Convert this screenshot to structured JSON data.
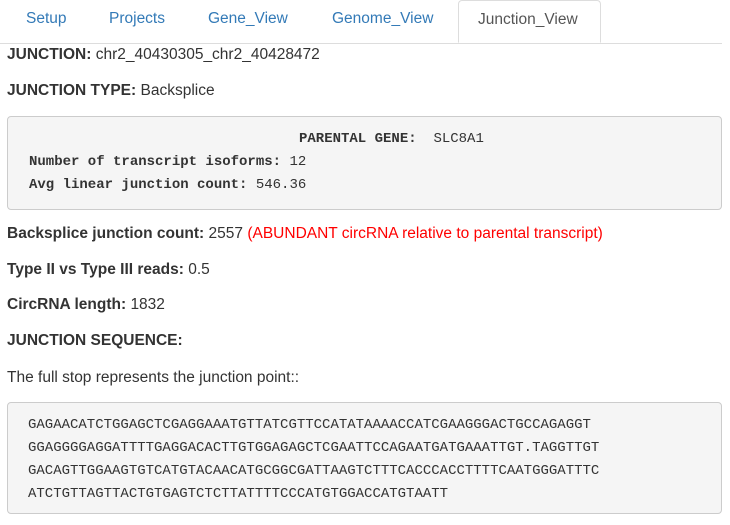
{
  "tabs": [
    {
      "label": "Setup",
      "active": false
    },
    {
      "label": "Projects",
      "active": false
    },
    {
      "label": "Gene_View",
      "active": false
    },
    {
      "label": "Genome_View",
      "active": false
    },
    {
      "label": "Junction_View",
      "active": true
    }
  ],
  "junction": {
    "label": "JUNCTION:",
    "value": "chr2_40430305_chr2_40428472"
  },
  "junction_type": {
    "label": "JUNCTION TYPE:",
    "value": "Backsplice"
  },
  "parental_box": {
    "gene_label": "PARENTAL GENE:",
    "gene_value": "SLC8A1",
    "isoforms_label": "Number of transcript isoforms:",
    "isoforms_value": "12",
    "avg_label": "Avg linear junction count:",
    "avg_value": "546.36"
  },
  "backsplice_count": {
    "label": "Backsplice junction count:",
    "value": "2557",
    "note": "(ABUNDANT circRNA relative to parental transcript)"
  },
  "type_reads": {
    "label": "Type II vs Type III reads:",
    "value": "0.5"
  },
  "circrna_length": {
    "label": "CircRNA length:",
    "value": "1832"
  },
  "junction_sequence": {
    "label": "JUNCTION SEQUENCE:",
    "description": "The full stop represents the junction point::",
    "lines": [
      "GAGAACATCTGGAGCTCGAGGAAATGTTATCGTTCCATATAAAACCATCGAAGGGACTGCCAGAGGT",
      "GGAGGGGAGGATTTTGAGGACACTTGTGGAGAGCTCGAATTCCAGAATGATGAAATTGT.TAGGTTGT",
      "GACAGTTGGAAGTGTCATGTACAACATGCGGCGATTAAGTCTTTCACCCACCTTTTCAATGGGATTTC",
      "ATCTGTTAGTTACTGTGAGTCTCTTATTTTCCCATGTGGACCATGTAATT"
    ]
  }
}
